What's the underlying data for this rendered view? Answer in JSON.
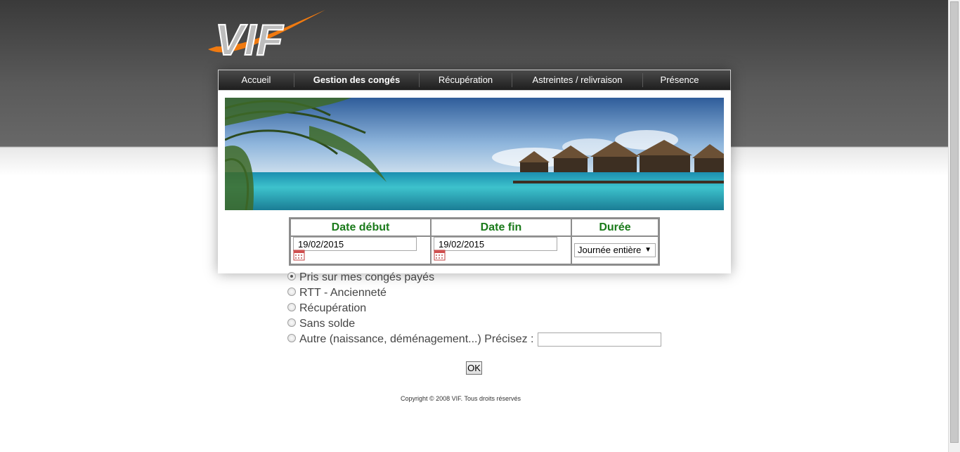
{
  "logo": {
    "text": "VIF",
    "accent": "#f07a10"
  },
  "nav": {
    "items": [
      {
        "label": "Accueil"
      },
      {
        "label": "Gestion des congés"
      },
      {
        "label": "Récupération"
      },
      {
        "label": "Astreintes / relivraison"
      },
      {
        "label": "Présence"
      }
    ],
    "active_index": 1
  },
  "banner": {
    "icon": "tropical-beach-banner-image"
  },
  "form": {
    "headers": {
      "start": "Date début",
      "end": "Date fin",
      "duration": "Durée"
    },
    "start_value": "19/02/2015",
    "end_value": "19/02/2015",
    "duration_value": "Journée entière",
    "header_color": "#1a7a1a",
    "radios": [
      {
        "label": "Pris sur mes congés payés",
        "checked": true
      },
      {
        "label": "RTT - Ancienneté",
        "checked": false
      },
      {
        "label": "Récupération",
        "checked": false
      },
      {
        "label": "Sans solde",
        "checked": false
      },
      {
        "label": "Autre (naissance, déménagement...) Précisez :",
        "checked": false
      }
    ],
    "other_value": "",
    "ok_label": "OK"
  },
  "footer": {
    "copyright": "Copyright © 2008 VIF. Tous droits réservés"
  }
}
